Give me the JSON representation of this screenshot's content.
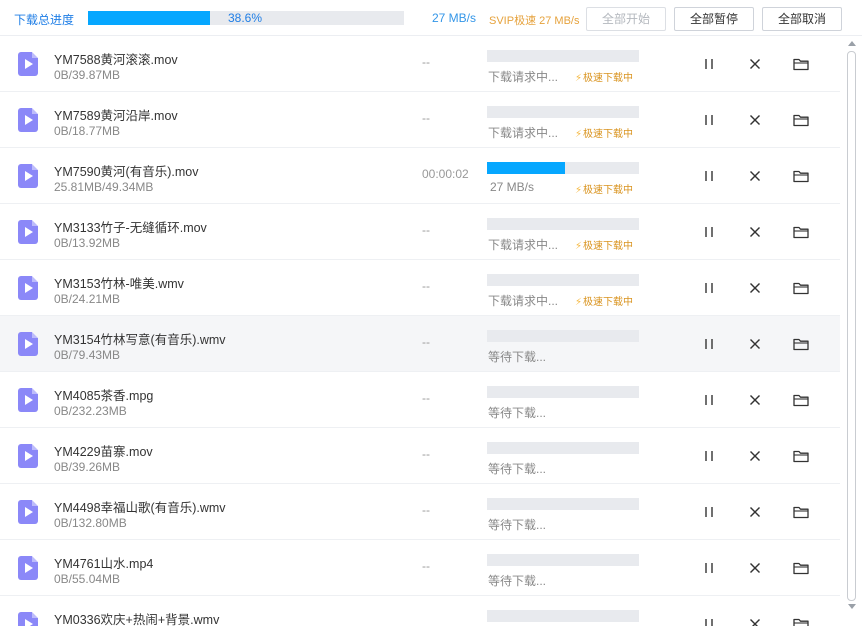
{
  "header": {
    "total_label": "下载总进度",
    "total_percent": "38.6%",
    "total_progress": 0.386,
    "speed": "27 MB/s",
    "svip_label": "SVIP极速 27 MB/s",
    "start_all": "全部开始",
    "pause_all": "全部暂停",
    "cancel_all": "全部取消"
  },
  "colors": {
    "accent": "#06a7ff",
    "link": "#1f7ee6",
    "svip": "#e6a23c",
    "file_icon": "#8b88f8"
  },
  "icons": {
    "file": "video-file-icon",
    "pause": "pause-icon",
    "close": "close-icon",
    "folder": "folder-icon",
    "boost": "lightning-icon"
  },
  "boost_label": "极速下载中",
  "rows": [
    {
      "name": "YM7588黄河滚滚.mov",
      "size": "0B/39.87MB",
      "time": "--",
      "status": "下载请求中...",
      "progress": 0,
      "boost": true
    },
    {
      "name": "YM7589黄河沿岸.mov",
      "size": "0B/18.77MB",
      "time": "--",
      "status": "下载请求中...",
      "progress": 0,
      "boost": true
    },
    {
      "name": "YM7590黄河(有音乐).mov",
      "size": "25.81MB/49.34MB",
      "time": "00:00:02",
      "status": "27 MB/s",
      "progress": 0.516,
      "boost": true
    },
    {
      "name": "YM3133竹子-无缝循环.mov",
      "size": "0B/13.92MB",
      "time": "--",
      "status": "下载请求中...",
      "progress": 0,
      "boost": true
    },
    {
      "name": "YM3153竹林-唯美.wmv",
      "size": "0B/24.21MB",
      "time": "--",
      "status": "下载请求中...",
      "progress": 0,
      "boost": true
    },
    {
      "name": "YM3154竹林写意(有音乐).wmv",
      "size": "0B/79.43MB",
      "time": "--",
      "status": "等待下载...",
      "progress": 0,
      "boost": false
    },
    {
      "name": "YM4085茶香.mpg",
      "size": "0B/232.23MB",
      "time": "--",
      "status": "等待下载...",
      "progress": 0,
      "boost": false
    },
    {
      "name": "YM4229苗寨.mov",
      "size": "0B/39.26MB",
      "time": "--",
      "status": "等待下载...",
      "progress": 0,
      "boost": false
    },
    {
      "name": "YM4498幸福山歌(有音乐).wmv",
      "size": "0B/132.80MB",
      "time": "--",
      "status": "等待下载...",
      "progress": 0,
      "boost": false
    },
    {
      "name": "YM4761山水.mp4",
      "size": "0B/55.04MB",
      "time": "--",
      "status": "等待下载...",
      "progress": 0,
      "boost": false
    },
    {
      "name": "YM0336欢庆+热闹+背景.wmv",
      "size": "",
      "time": "",
      "status": "",
      "progress": 0,
      "boost": false
    }
  ]
}
